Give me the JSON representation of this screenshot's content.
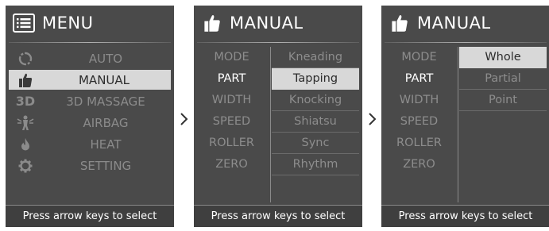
{
  "panel1": {
    "title": "MENU",
    "header_icon": "menu-list-icon",
    "items": [
      {
        "icon": "auto-cycle-icon",
        "label": "AUTO",
        "selected": false
      },
      {
        "icon": "thumbs-up-hand-icon",
        "label": "MANUAL",
        "selected": true
      },
      {
        "icon": "3d-text-icon",
        "icon_text": "3D",
        "label": "3D MASSAGE",
        "selected": false
      },
      {
        "icon": "airbag-person-icon",
        "label": "AIRBAG",
        "selected": false
      },
      {
        "icon": "flame-icon",
        "label": "HEAT",
        "selected": false
      },
      {
        "icon": "gear-icon",
        "label": "SETTING",
        "selected": false
      }
    ],
    "footer": "Press arrow keys to select"
  },
  "panel2": {
    "title": "MANUAL",
    "header_icon": "thumbs-up-hand-icon",
    "left_items": [
      "MODE",
      "PART",
      "WIDTH",
      "SPEED",
      "ROLLER",
      "ZERO"
    ],
    "left_active_index": 1,
    "right_items": [
      "Kneading",
      "Tapping",
      "Knocking",
      "Shiatsu",
      "Sync",
      "Rhythm"
    ],
    "right_selected_index": 1,
    "footer": "Press arrow keys to select"
  },
  "panel3": {
    "title": "MANUAL",
    "header_icon": "thumbs-up-hand-icon",
    "left_items": [
      "MODE",
      "PART",
      "WIDTH",
      "SPEED",
      "ROLLER",
      "ZERO"
    ],
    "left_active_index": 1,
    "right_items": [
      "Whole",
      "Partial",
      "Point"
    ],
    "right_selected_index": 0,
    "footer": "Press arrow keys to select"
  },
  "arrows": [
    "chevron-right-icon",
    "chevron-right-icon"
  ],
  "colors": {
    "panel_bg": "#4a4a4a",
    "highlight": "#d8d8d8",
    "text_dim": "#8b8b8b",
    "text_active": "#ffffff"
  }
}
